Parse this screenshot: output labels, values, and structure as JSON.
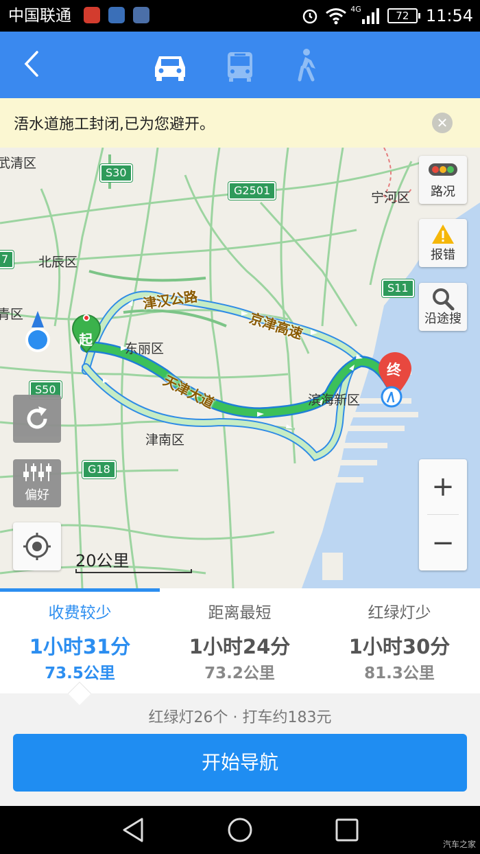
{
  "status_bar": {
    "carrier": "中国联通",
    "network": "4G",
    "battery": "72",
    "time": "11:54"
  },
  "header": {
    "back_icon": "chevron-left-icon",
    "modes": [
      {
        "name": "car-icon",
        "selected": true
      },
      {
        "name": "bus-icon",
        "selected": false
      },
      {
        "name": "walk-icon",
        "selected": false
      }
    ]
  },
  "notice": {
    "text": "浯水道施工封闭,已为您避开。",
    "close_icon": "close-icon"
  },
  "map": {
    "districts": [
      "武清区",
      "北辰区",
      "青区",
      "东丽区",
      "津南区",
      "宁河区",
      "滨海新区"
    ],
    "shields": [
      "S30",
      "G2501",
      "S11",
      "S50",
      "G18",
      "7"
    ],
    "roads": [
      "津汉公路",
      "京津高速",
      "天津大道"
    ],
    "start_marker": "起",
    "end_marker": "终",
    "side_buttons": {
      "traffic": "路况",
      "report": "报错",
      "search_along": "沿途搜",
      "preference": "偏好"
    },
    "zoom_in": "+",
    "zoom_out": "−",
    "scale": "20公里"
  },
  "routes": [
    {
      "title": "收费较少",
      "time": "1小时31分",
      "distance": "73.5公里",
      "active": true
    },
    {
      "title": "距离最短",
      "time": "1小时24分",
      "distance": "73.2公里",
      "active": false
    },
    {
      "title": "红绿灯少",
      "time": "1小时30分",
      "distance": "81.3公里",
      "active": false
    }
  ],
  "summary": {
    "text": "红绿灯26个 · 打车约183元"
  },
  "start_button": "开始导航",
  "watermark": "汽车之家",
  "colors": {
    "header_blue": "#3a89ef",
    "accent_blue": "#2c8ef0",
    "route_green": "#3cc05a",
    "notice_bg": "#fbf7d2",
    "shield_green": "#2e9a5a"
  }
}
